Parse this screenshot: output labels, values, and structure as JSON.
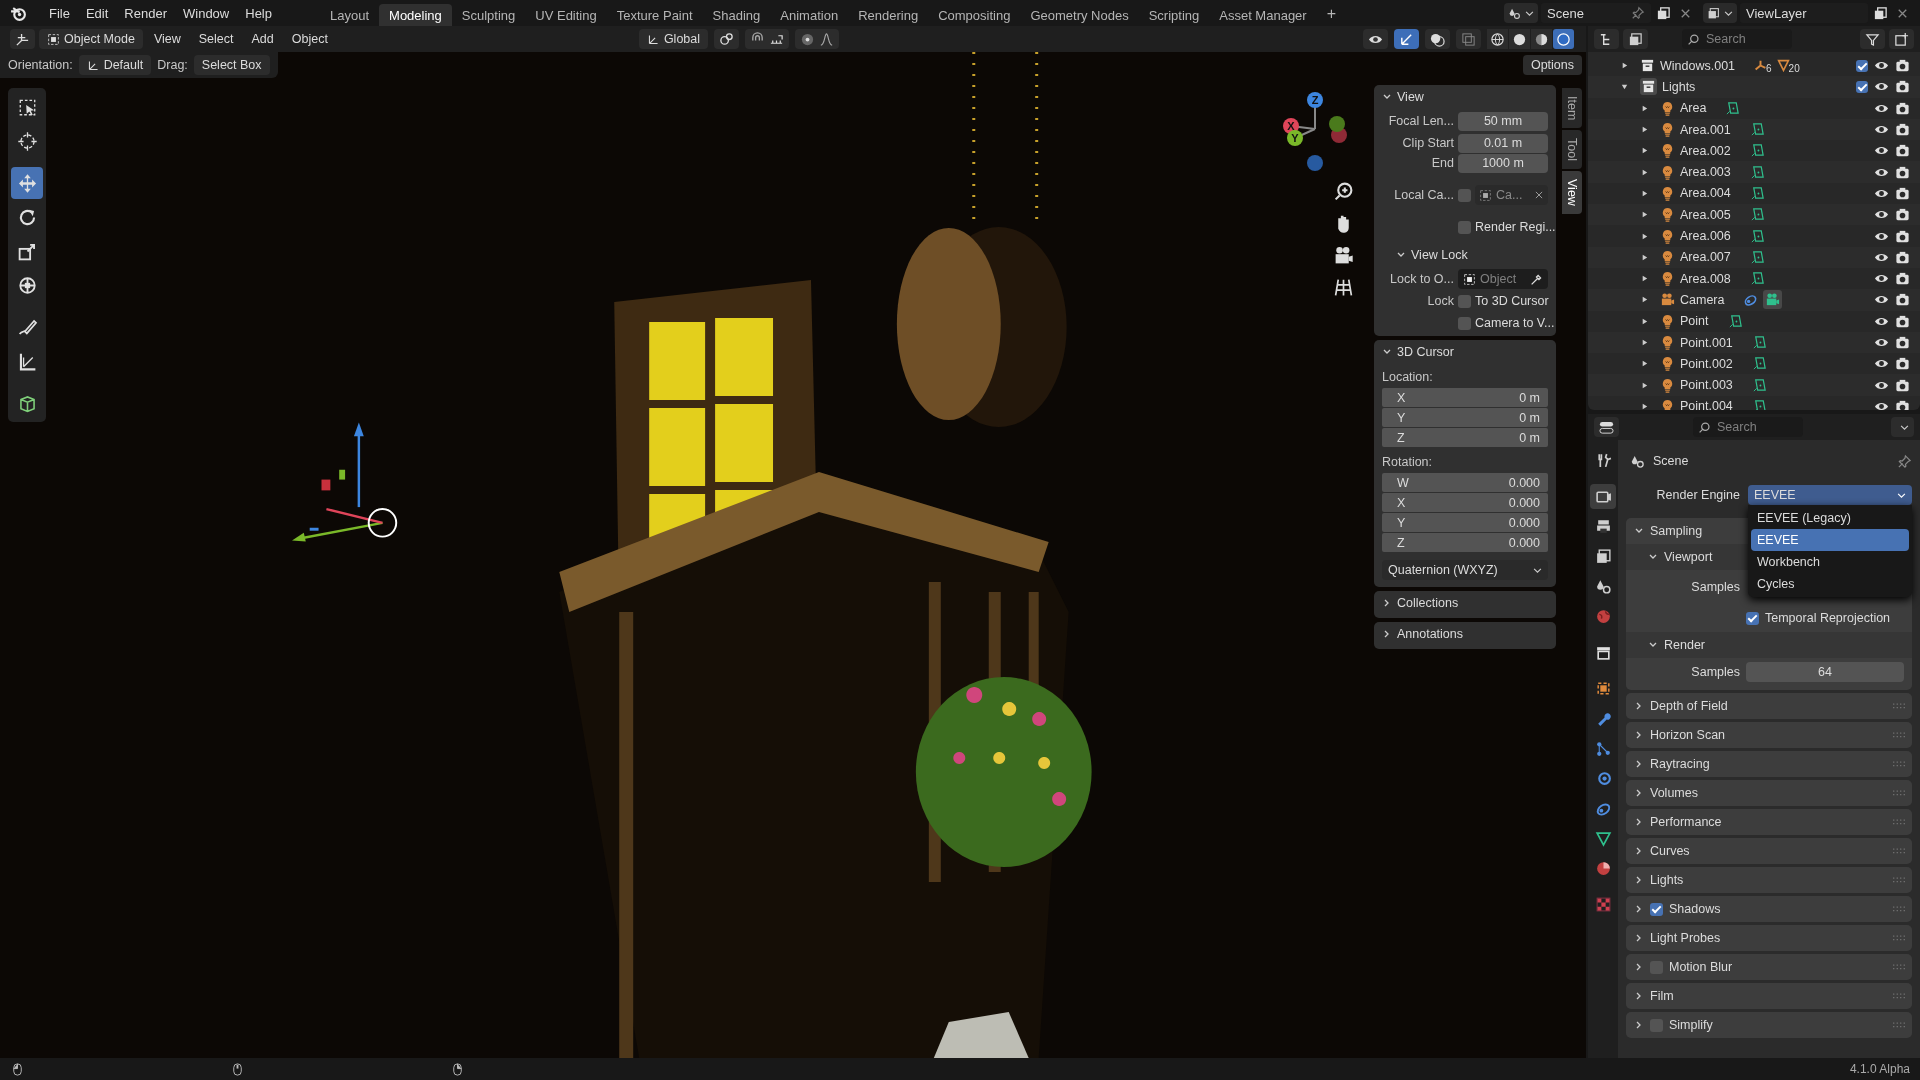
{
  "top_bar": {
    "menus": [
      "File",
      "Edit",
      "Render",
      "Window",
      "Help"
    ],
    "workspaces": [
      {
        "label": "Layout",
        "selected": false
      },
      {
        "label": "Modeling",
        "selected": true
      },
      {
        "label": "Sculpting",
        "selected": false
      },
      {
        "label": "UV Editing",
        "selected": false
      },
      {
        "label": "Texture Paint",
        "selected": false
      },
      {
        "label": "Shading",
        "selected": false
      },
      {
        "label": "Animation",
        "selected": false
      },
      {
        "label": "Rendering",
        "selected": false
      },
      {
        "label": "Compositing",
        "selected": false
      },
      {
        "label": "Geometry Nodes",
        "selected": false
      },
      {
        "label": "Scripting",
        "selected": false
      },
      {
        "label": "Asset Manager",
        "selected": false
      }
    ],
    "add_tab": "+",
    "scene": "Scene",
    "view_layer": "ViewLayer"
  },
  "viewport_header": {
    "mode": "Object Mode",
    "menus": [
      "View",
      "Select",
      "Add",
      "Object"
    ],
    "orientation": "Global",
    "shading_modes": [
      {
        "kind": "wireframe",
        "selected": false
      },
      {
        "kind": "solid",
        "selected": false
      },
      {
        "kind": "material",
        "selected": false
      },
      {
        "kind": "rendered",
        "selected": true
      }
    ]
  },
  "tool_settings": {
    "orientation_label": "Orientation:",
    "orientation": "Default",
    "drag_label": "Drag:",
    "drag": "Select Box",
    "options": "Options"
  },
  "toolbar": [
    {
      "kind": "select",
      "selected": false
    },
    {
      "kind": "cursor",
      "selected": false
    },
    {
      "kind": "move",
      "selected": true
    },
    {
      "kind": "rotate",
      "selected": false
    },
    {
      "kind": "scale",
      "selected": false
    },
    {
      "kind": "transform",
      "selected": false
    },
    {
      "kind": "annotate",
      "selected": false
    },
    {
      "kind": "measure",
      "selected": false
    },
    {
      "kind": "add_cube",
      "selected": false
    }
  ],
  "navigation_gizmo": {
    "axes": [
      {
        "label": "X",
        "color": "#e0455a"
      },
      {
        "label": "Y",
        "color": "#7ab829"
      },
      {
        "label": "Z",
        "color": "#3d86e0"
      }
    ]
  },
  "sidebar_tabs": [
    {
      "label": "Item",
      "selected": false
    },
    {
      "label": "Tool",
      "selected": false
    },
    {
      "label": "View",
      "selected": true
    }
  ],
  "sidebar": {
    "view_panel": {
      "title": "View",
      "expanded": true,
      "fields": [
        {
          "label": "Focal Len...",
          "value": "50 mm"
        },
        {
          "label": "Clip Start",
          "value": "0.01 m"
        },
        {
          "label": "End",
          "value": "1000 m"
        }
      ],
      "local_camera": {
        "label": "Local Ca...",
        "checked": false,
        "value": "Ca..."
      },
      "render_region": {
        "label": "Render Regi...",
        "checked": false
      },
      "view_lock": {
        "title": "View Lock",
        "expanded": true,
        "lock_to": {
          "label": "Lock to O...",
          "placeholder": "Object"
        },
        "lock_label": "Lock",
        "options": [
          {
            "label": "To 3D Cursor",
            "checked": false
          },
          {
            "label": "Camera to V...",
            "checked": false
          }
        ]
      }
    },
    "cursor_panel": {
      "title": "3D Cursor",
      "expanded": true,
      "location_label": "Location:",
      "location": [
        {
          "axis": "X",
          "value": "0 m"
        },
        {
          "axis": "Y",
          "value": "0 m"
        },
        {
          "axis": "Z",
          "value": "0 m"
        }
      ],
      "rotation_label": "Rotation:",
      "rotation": [
        {
          "axis": "W",
          "value": "0.000"
        },
        {
          "axis": "X",
          "value": "0.000"
        },
        {
          "axis": "Y",
          "value": "0.000"
        },
        {
          "axis": "Z",
          "value": "0.000"
        }
      ],
      "rotation_mode": "Quaternion (WXYZ)"
    },
    "more_panels": [
      {
        "title": "Collections",
        "expanded": false
      },
      {
        "title": "Annotations",
        "expanded": false
      }
    ]
  },
  "outliner": {
    "search": {
      "placeholder": "Search"
    },
    "items": [
      {
        "name": "Windows.001",
        "kind": "collection",
        "expanded": false,
        "checked": true,
        "counts": [
          "6",
          "20"
        ]
      },
      {
        "name": "Lights",
        "kind": "collection",
        "expanded": true,
        "checked": true,
        "children": [
          {
            "name": "Area",
            "kind": "light",
            "expanded": false
          },
          {
            "name": "Area.001",
            "kind": "light",
            "expanded": false
          },
          {
            "name": "Area.002",
            "kind": "light",
            "expanded": false
          },
          {
            "name": "Area.003",
            "kind": "light",
            "expanded": false
          },
          {
            "name": "Area.004",
            "kind": "light",
            "expanded": false
          },
          {
            "name": "Area.005",
            "kind": "light",
            "expanded": false
          },
          {
            "name": "Area.006",
            "kind": "light",
            "expanded": false
          },
          {
            "name": "Area.007",
            "kind": "light",
            "expanded": false
          },
          {
            "name": "Area.008",
            "kind": "light",
            "expanded": false
          },
          {
            "name": "Camera",
            "kind": "camera",
            "expanded": false
          },
          {
            "name": "Point",
            "kind": "light",
            "expanded": false
          },
          {
            "name": "Point.001",
            "kind": "light",
            "expanded": false
          },
          {
            "name": "Point.002",
            "kind": "light",
            "expanded": false
          },
          {
            "name": "Point.003",
            "kind": "light",
            "expanded": false
          },
          {
            "name": "Point.004",
            "kind": "light",
            "expanded": false
          }
        ]
      }
    ]
  },
  "properties": {
    "search": {
      "placeholder": "Search"
    },
    "tabs": [
      {
        "kind": "tool",
        "selected": false
      },
      {
        "kind": "render",
        "selected": true
      },
      {
        "kind": "output",
        "selected": false
      },
      {
        "kind": "view_layer",
        "selected": false
      },
      {
        "kind": "scene",
        "selected": false
      },
      {
        "kind": "world",
        "selected": false
      },
      {
        "kind": "collection",
        "selected": false
      },
      {
        "kind": "object",
        "selected": false
      },
      {
        "kind": "modifiers",
        "selected": false
      },
      {
        "kind": "particles",
        "selected": false
      },
      {
        "kind": "physics",
        "selected": false
      },
      {
        "kind": "constraints",
        "selected": false
      },
      {
        "kind": "data",
        "selected": false
      },
      {
        "kind": "material",
        "selected": false
      },
      {
        "kind": "texture",
        "selected": false
      }
    ],
    "context": "Scene",
    "render_engine": {
      "label": "Render Engine",
      "value": "EEVEE",
      "open": true,
      "options": [
        {
          "label": "EEVEE (Legacy)",
          "selected": false
        },
        {
          "label": "EEVEE",
          "selected": true
        },
        {
          "label": "Workbench",
          "selected": false
        },
        {
          "label": "Cycles",
          "selected": false
        }
      ]
    },
    "sampling": {
      "title": "Sampling",
      "expanded": true,
      "viewport": {
        "title": "Viewport",
        "expanded": true,
        "samples_label": "Samples",
        "temporal": {
          "label": "Temporal Reprojection",
          "checked": true
        }
      },
      "render": {
        "title": "Render",
        "expanded": true,
        "samples_label": "Samples",
        "samples": "64"
      }
    },
    "panels": [
      {
        "title": "Depth of Field",
        "expanded": false
      },
      {
        "title": "Horizon Scan",
        "expanded": false
      },
      {
        "title": "Raytracing",
        "expanded": false
      },
      {
        "title": "Volumes",
        "expanded": false
      },
      {
        "title": "Performance",
        "expanded": false
      },
      {
        "title": "Curves",
        "expanded": false
      },
      {
        "title": "Lights",
        "expanded": false
      },
      {
        "title": "Shadows",
        "expanded": false,
        "checked": true
      },
      {
        "title": "Light Probes",
        "expanded": false
      },
      {
        "title": "Motion Blur",
        "expanded": false,
        "checked": false
      },
      {
        "title": "Film",
        "expanded": false
      },
      {
        "title": "Simplify",
        "expanded": false,
        "checked": false
      }
    ]
  },
  "status_bar": {
    "version": "4.1.0 Alpha"
  }
}
